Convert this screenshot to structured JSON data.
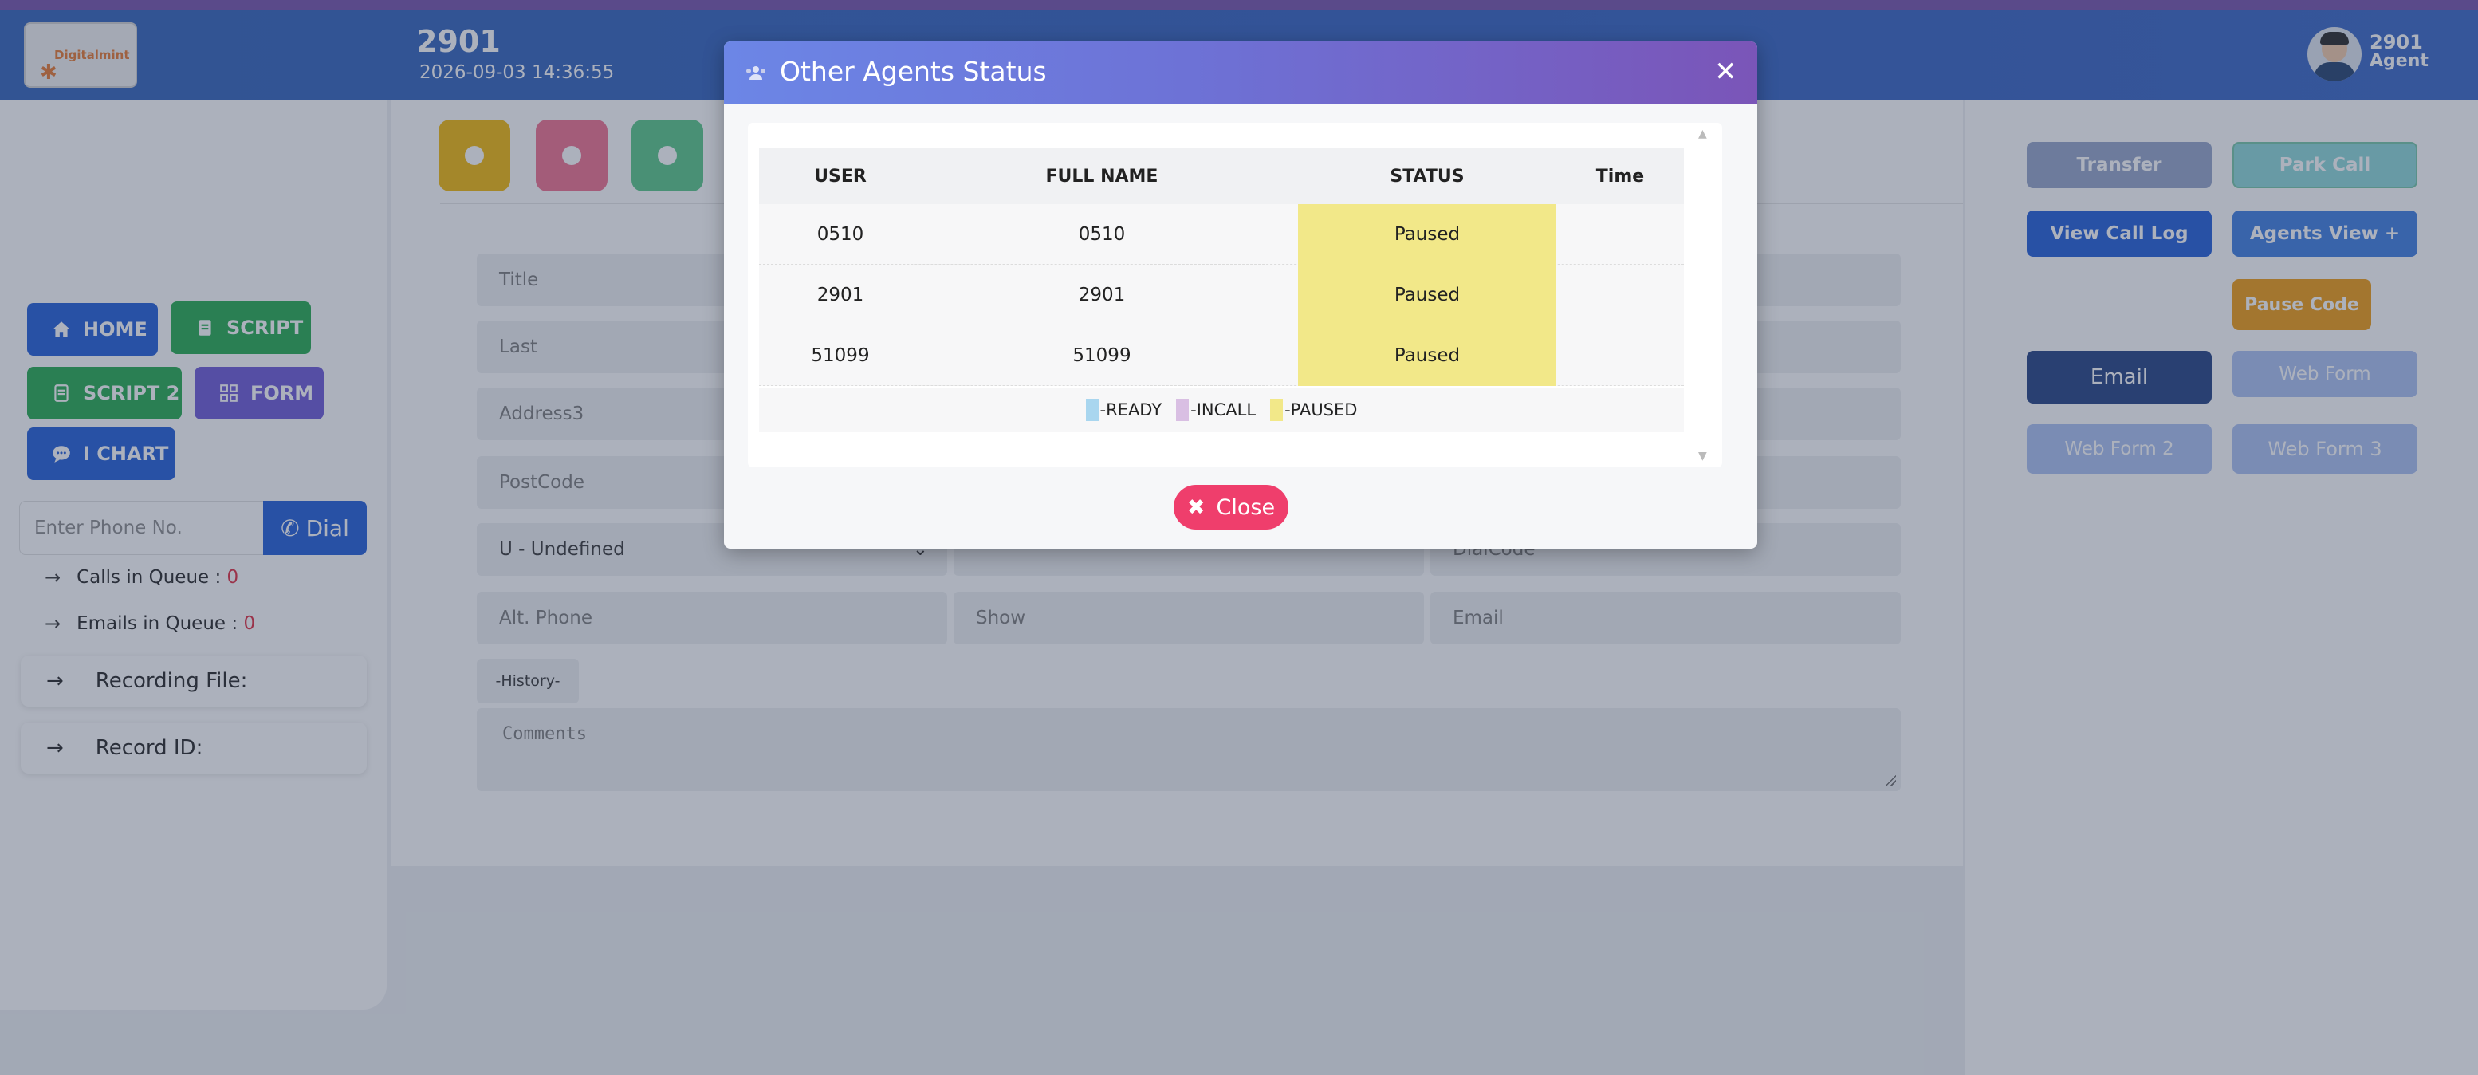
{
  "header": {
    "logo_text": "Digitalmint",
    "agent_number": "2901",
    "datetime": "2026-09-03 14:36:55",
    "user_name": "2901",
    "user_role": "Agent"
  },
  "sidebar": {
    "buttons": {
      "home": "HOME",
      "script": "SCRIPT",
      "script2": "SCRIPT 2",
      "form": "FORM",
      "ichart": "I CHART"
    },
    "phone_placeholder": "Enter Phone No.",
    "dial_label": "Dial",
    "calls_queue_label": "Calls in Queue :",
    "calls_queue_count": "0",
    "emails_queue_label": "Emails in Queue :",
    "emails_queue_count": "0",
    "recording_file_label": "Recording File:",
    "record_id_label": "Record ID:"
  },
  "form": {
    "title": "Title",
    "last": "Last",
    "address3": "Address3",
    "postcode": "PostCode",
    "gender_value": "U - Undefined",
    "dialcode": "DialCode",
    "alt_phone": "Alt. Phone",
    "show": "Show",
    "email": "Email",
    "history": "-History-",
    "comments": "Comments"
  },
  "right_panel": {
    "transfer": "Transfer",
    "park_call": "Park Call",
    "view_call_log": "View Call Log",
    "agents_view": "Agents View +",
    "pause_code": "Pause Code",
    "email": "Email",
    "web_form": "Web Form",
    "web_form2": "Web Form 2",
    "web_form3": "Web Form 3"
  },
  "modal": {
    "title": "Other Agents Status",
    "columns": {
      "user": "USER",
      "full_name": "FULL NAME",
      "status": "STATUS",
      "time": "Time"
    },
    "rows": [
      {
        "user": "0510",
        "full_name": "0510",
        "status": "Paused",
        "time": ""
      },
      {
        "user": "2901",
        "full_name": "2901",
        "status": "Paused",
        "time": ""
      },
      {
        "user": "51099",
        "full_name": "51099",
        "status": "Paused",
        "time": ""
      }
    ],
    "legend": {
      "ready": "-READY",
      "incall": "-INCALL",
      "paused": "-PAUSED"
    },
    "close_label": "Close"
  },
  "colors": {
    "header": "#2f5ec0",
    "paused": "#f2e889",
    "ready": "#a9d6ef",
    "incall": "#d9bfe3",
    "close": "#ef3e6c"
  }
}
